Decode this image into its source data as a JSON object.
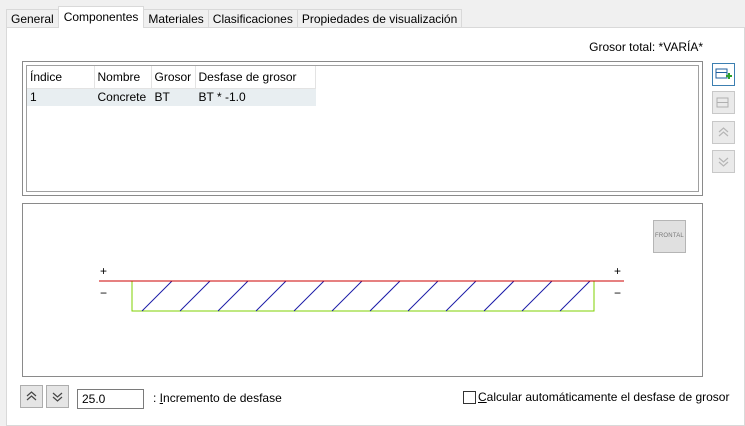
{
  "tabs": [
    "General",
    "Componentes",
    "Materiales",
    "Clasificaciones",
    "Propiedades de visualización"
  ],
  "total_thickness": "Grosor total: *VARÍA*",
  "grid": {
    "headers": [
      "Índice",
      "Nombre",
      "Grosor",
      "Desfase de grosor"
    ],
    "rows": [
      [
        "1",
        "Concrete",
        "BT",
        "BT * -1.0"
      ]
    ]
  },
  "preview": {
    "plus_left": "+",
    "plus_right": "+",
    "minus_left": "−",
    "minus_right": "−",
    "frontal_label": "FRONTAL",
    "colors": {
      "top_line": "#cc0000",
      "outline": "#7fd000",
      "hatch": "#1a1aa8"
    }
  },
  "offset_increment": {
    "value": "25.0",
    "label_prefix": ": ",
    "label_underlined": "I",
    "label_rest": "ncremento de desfase"
  },
  "auto_offset": {
    "label_underlined": "C",
    "label_rest": "alcular automáticamente el desfase de grosor",
    "checked": false
  },
  "side_buttons": [
    "add-component-icon",
    "remove-component-icon",
    "move-up-icon",
    "move-down-icon"
  ]
}
